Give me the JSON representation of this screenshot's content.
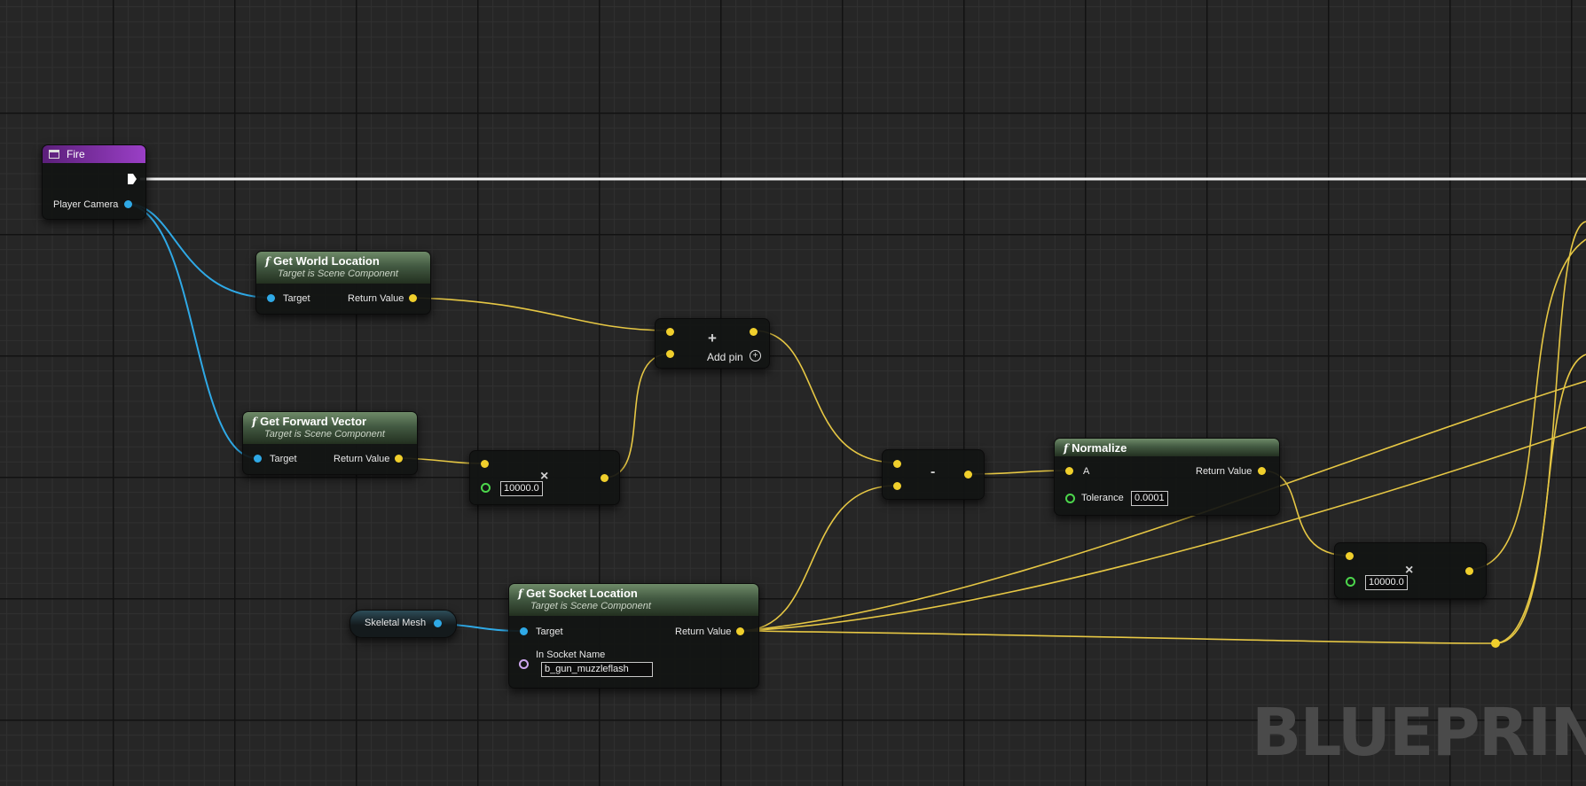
{
  "event_node": {
    "title": "Fire",
    "pin_label": "Player Camera"
  },
  "get_world_location": {
    "title": "Get World Location",
    "subtitle": "Target is Scene Component",
    "target_label": "Target",
    "return_label": "Return Value"
  },
  "get_forward_vector": {
    "title": "Get Forward Vector",
    "subtitle": "Target is Scene Component",
    "target_label": "Target",
    "return_label": "Return Value"
  },
  "multiply_node_1": {
    "symbol": "×",
    "value": "10000.0"
  },
  "add_node": {
    "symbol": "+",
    "add_pin_label": "Add pin"
  },
  "subtract_node": {
    "symbol": "-"
  },
  "normalize": {
    "title": "Normalize",
    "a_label": "A",
    "return_label": "Return Value",
    "tolerance_label": "Tolerance",
    "tolerance_value": "0.0001"
  },
  "multiply_node_2": {
    "symbol": "×",
    "value": "10000.0"
  },
  "skeletal_mesh": {
    "label": "Skeletal Mesh"
  },
  "get_socket_location": {
    "title": "Get Socket Location",
    "subtitle": "Target is Scene Component",
    "target_label": "Target",
    "return_label": "Return Value",
    "socket_label": "In Socket Name",
    "socket_value": "b_gun_muzzleflash"
  },
  "watermark": "BLUEPRINT",
  "colors": {
    "object_pin": "#2fa9e6",
    "vector_pin": "#f0cf2c",
    "float_pin": "#4cd64c",
    "name_pin": "#cda6ee",
    "exec_wire": "#ffffff",
    "event_header": "#7a2aa0",
    "function_header": "#435a42"
  }
}
